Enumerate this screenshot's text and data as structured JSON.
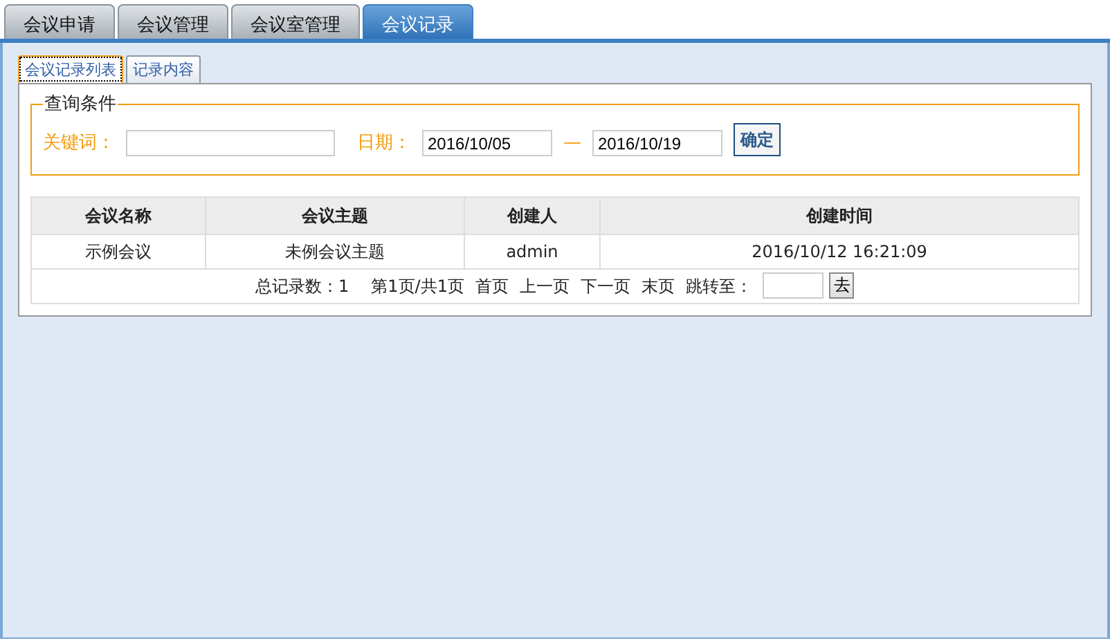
{
  "tabs": [
    {
      "label": "会议申请",
      "selected": false
    },
    {
      "label": "会议管理",
      "selected": false
    },
    {
      "label": "会议室管理",
      "selected": false
    },
    {
      "label": "会议记录",
      "selected": true
    }
  ],
  "sub_tabs": [
    {
      "label": "会议记录列表",
      "selected": true
    },
    {
      "label": "记录内容",
      "selected": false
    }
  ],
  "query": {
    "legend": "查询条件",
    "keyword_label": "关键词：",
    "date_label": "日期：",
    "date_from": "2016/10/05",
    "separator": "—",
    "date_to": "2016/10/19",
    "submit": "确定"
  },
  "table": {
    "columns": [
      "会议名称",
      "会议主题",
      "创建人",
      "创建时间"
    ],
    "rows": [
      [
        "示例会议",
        "未例会议主题",
        "admin",
        "2016/10/12 16:21:09"
      ]
    ]
  },
  "pager": {
    "total": "总记录数：1",
    "page_info": "第1页/共1页",
    "links": [
      "首页",
      "上一页",
      "下一页",
      "末页"
    ],
    "jump_label": "跳转至：",
    "go": "去"
  }
}
